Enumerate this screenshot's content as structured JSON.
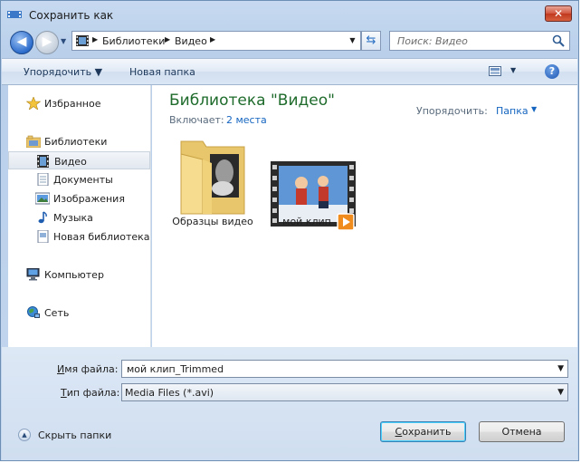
{
  "window": {
    "title": "Сохранить как",
    "close_glyph": "✕"
  },
  "nav": {
    "back_glyph": "◀",
    "forward_glyph": "▶",
    "history_glyph": "▼"
  },
  "address": {
    "crumbs": [
      "Библиотеки",
      "Видео"
    ],
    "sep": "▶",
    "dropdown_glyph": "▼",
    "refresh_glyph": "⇆"
  },
  "search": {
    "placeholder": "Поиск: Видео"
  },
  "toolbar": {
    "organize": "Упорядочить ▼",
    "new_folder": "Новая папка",
    "view_dd": "▼",
    "help": "?"
  },
  "sidebar": {
    "items": [
      {
        "label": "Избранное",
        "icon": "star-icon"
      },
      {
        "label": "Библиотеки",
        "icon": "libraries-icon"
      },
      {
        "label": "Видео",
        "icon": "video-icon",
        "selected": true
      },
      {
        "label": "Документы",
        "icon": "documents-icon"
      },
      {
        "label": "Изображения",
        "icon": "pictures-icon"
      },
      {
        "label": "Музыка",
        "icon": "music-icon"
      },
      {
        "label": "Новая библиотека",
        "icon": "new-library-icon"
      },
      {
        "label": "Компьютер",
        "icon": "computer-icon"
      },
      {
        "label": "Сеть",
        "icon": "network-icon"
      }
    ]
  },
  "library": {
    "title": "Библиотека \"Видео\"",
    "includes_label": "Включает:",
    "includes_link": "2 места",
    "arrange_label": "Упорядочить:",
    "arrange_value": "Папка",
    "arrange_dd": "▼"
  },
  "files": [
    {
      "name": "Образцы видео",
      "type": "folder"
    },
    {
      "name": "мой клип",
      "type": "video"
    }
  ],
  "form": {
    "filename_label_u": "И",
    "filename_label_rest": "мя файла:",
    "filename_value": "мой клип_Trimmed",
    "filetype_label_u": "Т",
    "filetype_label_rest": "ип файла:",
    "filetype_value": "Media Files (*.avi)",
    "dd_glyph": "▼"
  },
  "footer": {
    "hide_folders": "Скрыть папки",
    "hide_glyph": "▲",
    "save_u": "С",
    "save_rest": "охранить",
    "cancel": "Отмена"
  },
  "colors": {
    "library_title": "#1e6b2b",
    "link": "#1565c0",
    "accent": "#2c6ccc"
  }
}
